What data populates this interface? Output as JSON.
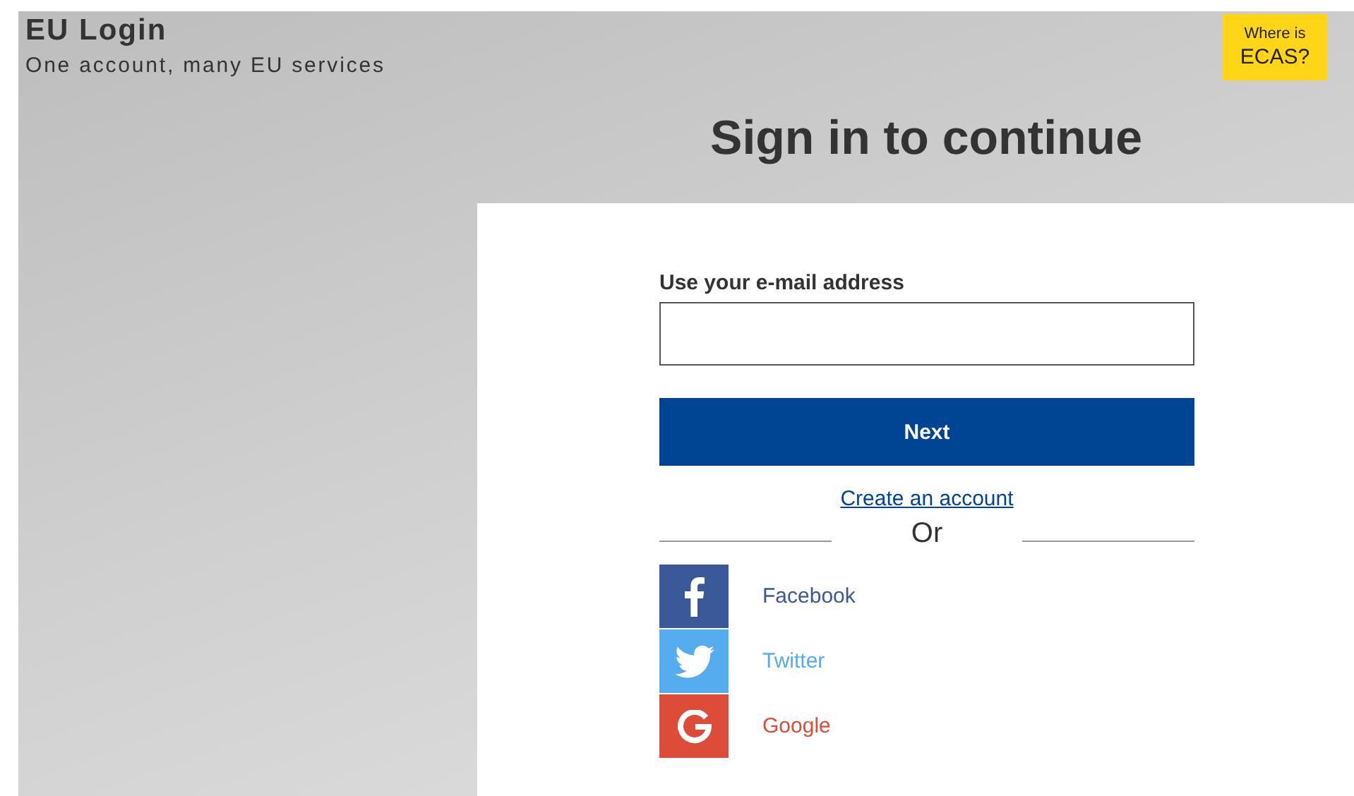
{
  "header": {
    "title": "EU Login",
    "subtitle": "One account, many EU services"
  },
  "ecas_badge": {
    "line_1": "Where is",
    "line_2": "ECAS?"
  },
  "heading": "Sign in to continue",
  "form": {
    "label": "Use your e-mail address",
    "button": "Next",
    "create_link": "Create an account",
    "separator": "Or"
  },
  "providers": [
    {
      "kind": "facebook",
      "label": "Facebook",
      "color": "#3b5998"
    },
    {
      "kind": "twitter",
      "label": "Twitter",
      "color": "#55acee"
    },
    {
      "kind": "google",
      "label": "Google",
      "color": "#dd4b39"
    }
  ]
}
